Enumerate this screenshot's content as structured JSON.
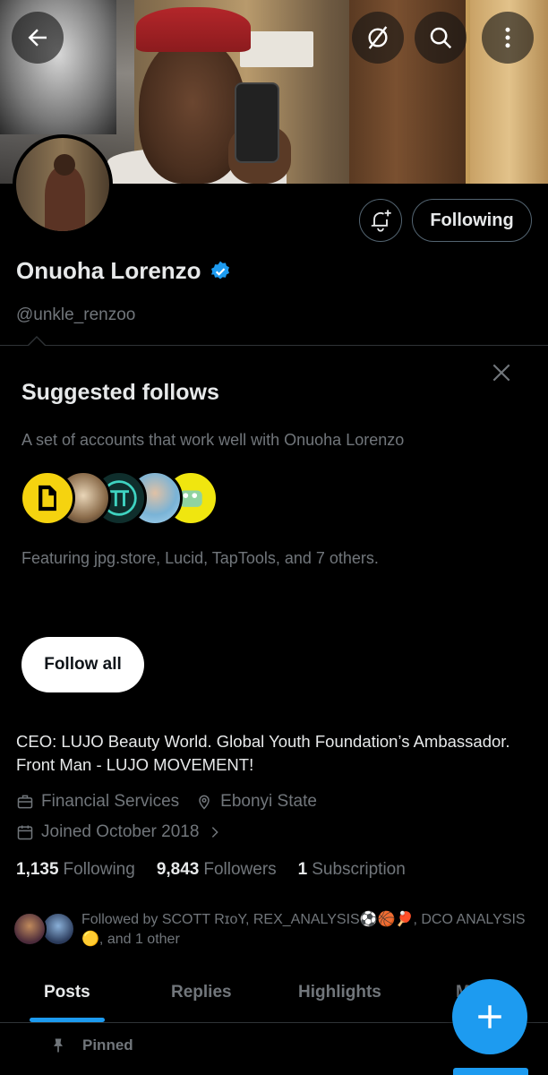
{
  "colors": {
    "accent": "#1d9bf0",
    "muted": "#71767b",
    "text": "#e7e9ea",
    "background": "#000000"
  },
  "header": {
    "back_icon": "arrow-left-icon",
    "grok_icon": "slash-circle-icon",
    "search_icon": "search-icon",
    "more_icon": "more-vertical-icon"
  },
  "profile": {
    "name": "Onuoha Lorenzo",
    "handle": "@unkle_renzoo",
    "following_button": "Following",
    "notify_icon": "bell-plus-icon",
    "verified_icon": "verified-badge-icon"
  },
  "suggested": {
    "title": "Suggested follows",
    "description": "A set of accounts that work well with Onuoha Lorenzo",
    "featuring": "Featuring jpg.store, Lucid, TapTools, and 7 others.",
    "follow_all": "Follow all",
    "close_icon": "close-icon"
  },
  "bio": {
    "text": "CEO: LUJO Beauty World. Global Youth Foundation’s Ambassador. Front Man - LUJO MOVEMENT!",
    "category": "Financial Services",
    "location": "Ebonyi State",
    "joined": "Joined October 2018",
    "category_icon": "briefcase-icon",
    "location_icon": "map-pin-icon",
    "joined_icon": "calendar-icon",
    "joined_chevron_icon": "chevron-right-icon"
  },
  "stats": {
    "following_count": "1,135",
    "following_label": "Following",
    "followers_count": "9,843",
    "followers_label": "Followers",
    "subscription_count": "1",
    "subscription_label": "Subscription"
  },
  "followed_by": {
    "text": "Followed by SCOTT RɪᴏY, REX_ANALYSIS⚽🏀🏓, DCO ANALYSIS 🟡, and 1 other"
  },
  "tabs": [
    "Posts",
    "Replies",
    "Highlights",
    "M"
  ],
  "pinned": {
    "label": "Pinned",
    "icon": "pin-icon"
  },
  "fab": {
    "icon": "plus-icon"
  }
}
